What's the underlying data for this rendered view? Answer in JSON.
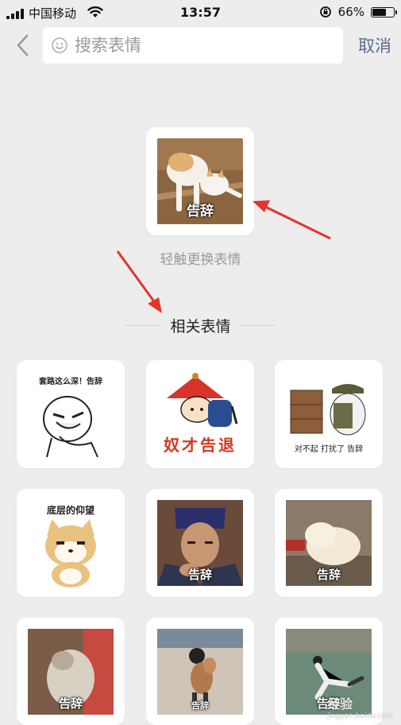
{
  "status": {
    "carrier": "中国移动",
    "time": "13:57",
    "battery": "66%",
    "battery_level": 0.66
  },
  "search": {
    "placeholder": "搜索表情",
    "cancel_label": "取消"
  },
  "featured": {
    "caption": "告辞"
  },
  "hint": "轻触更换表情",
  "section_title": "相关表情",
  "stickers": [
    {
      "top_text": "套路这么深！告辞"
    },
    {
      "caption": "奴才告退"
    },
    {
      "bottom_text": "对不起  打扰了  告辞"
    },
    {
      "top_text": "底层的仰望"
    },
    {
      "caption": "告辞"
    },
    {
      "caption": "告辞"
    },
    {
      "caption": "告辞"
    },
    {
      "caption": "告辞"
    },
    {
      "caption": "告辞"
    }
  ],
  "watermark": {
    "text": "经验",
    "url": "jingyan.baidu.com"
  }
}
